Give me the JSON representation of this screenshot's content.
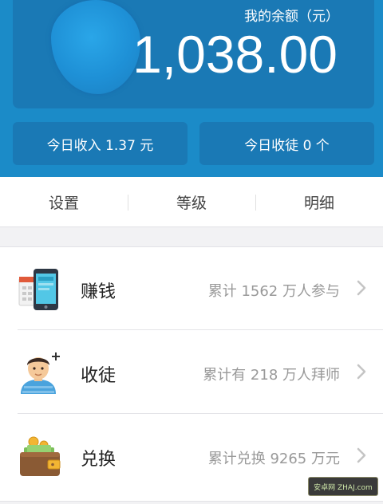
{
  "header": {
    "balance_label": "我的余额（元）",
    "balance_value": "1,038.00",
    "today_income": "今日收入 1.37 元",
    "today_apprentices": "今日收徒 0 个"
  },
  "nav": {
    "settings": "设置",
    "level": "等级",
    "details": "明细"
  },
  "list": [
    {
      "title": "赚钱",
      "subtitle": "累计 1562 万人参与",
      "icon": "phone-calendar-icon"
    },
    {
      "title": "收徒",
      "subtitle": "累计有 218 万人拜师",
      "icon": "person-add-icon"
    },
    {
      "title": "兑换",
      "subtitle": "累计兑换 9265 万元",
      "icon": "wallet-icon"
    }
  ],
  "watermark": {
    "text": "安卓网 ZHAJ.com"
  },
  "colors": {
    "brand_blue": "#1b8bc8",
    "card_blue": "#1a79b5",
    "background": "#f2f2f4"
  }
}
